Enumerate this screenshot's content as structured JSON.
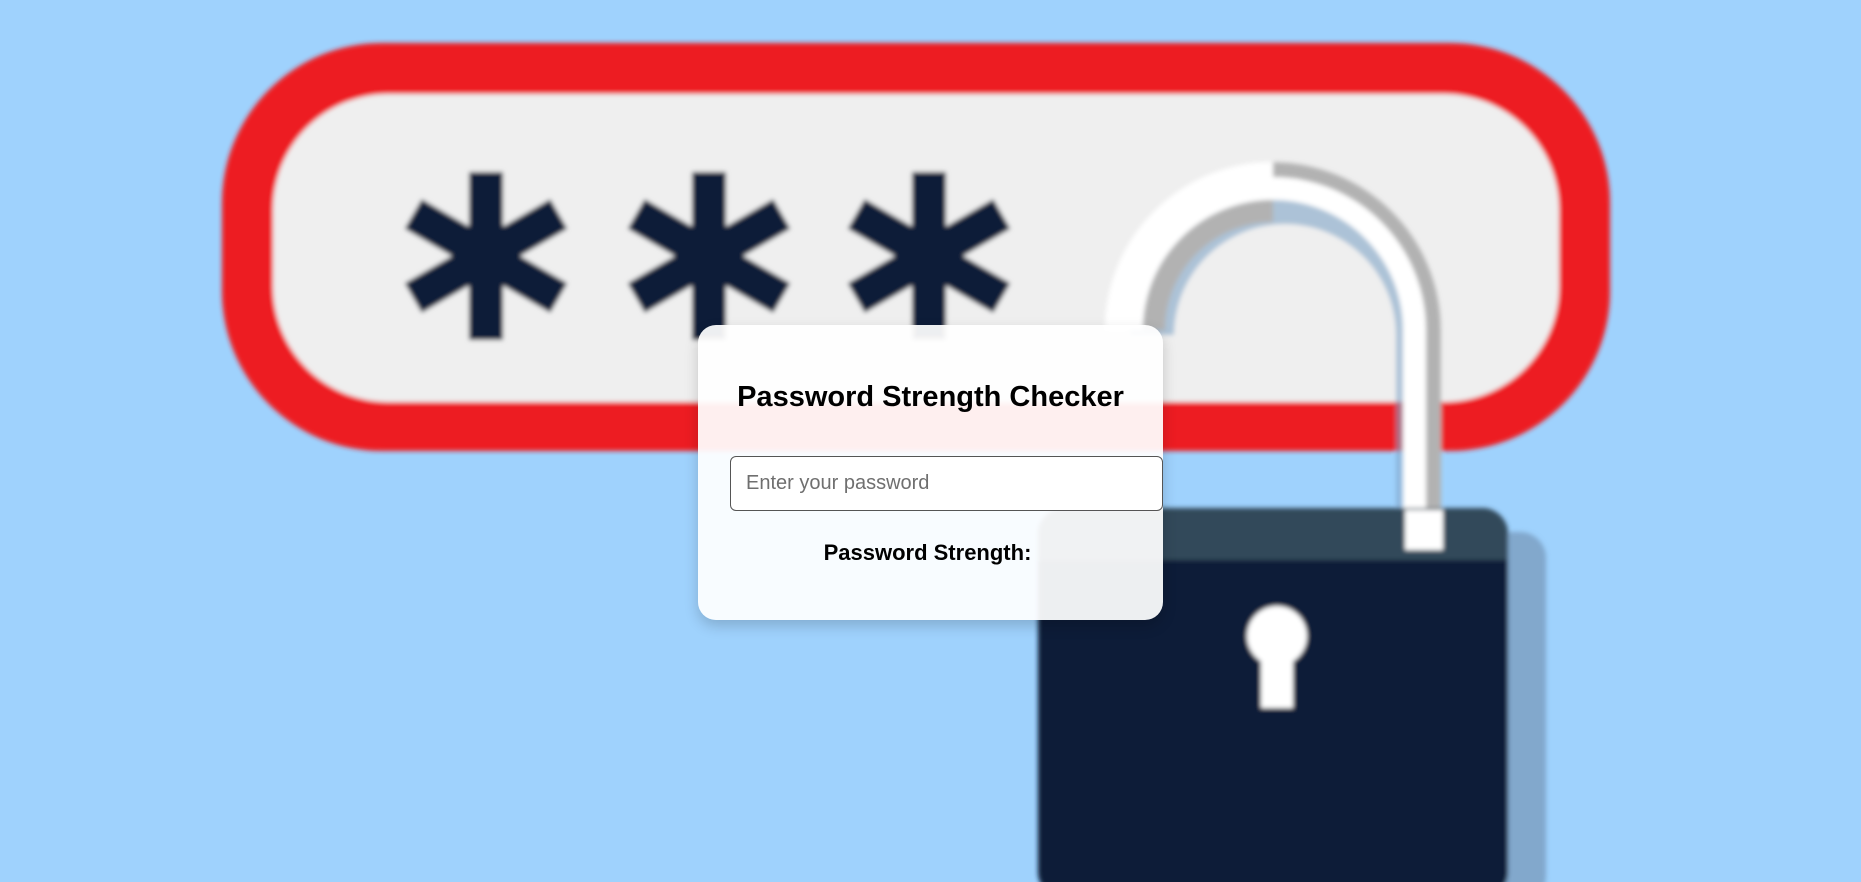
{
  "background": {
    "sky_color": "#9fd2fd",
    "field_border_color": "#ed1c24",
    "field_fill_color": "#efefef",
    "asterisk_color": "#0f1f38",
    "asterisks": [
      "*",
      "*",
      "*"
    ],
    "lock_body_color": "#0f1f38",
    "lock_top_band_color": "#33495a",
    "shackle_color": "#ffffff",
    "shackle_shadow_color": "#b2b2b2",
    "icons": [
      "password-field-graphic",
      "padlock-icon",
      "keyhole-icon"
    ]
  },
  "card": {
    "title": "Password Strength Checker",
    "password_placeholder": "Enter your password",
    "password_value": "",
    "strength_label": "Password Strength:",
    "strength_value": ""
  }
}
